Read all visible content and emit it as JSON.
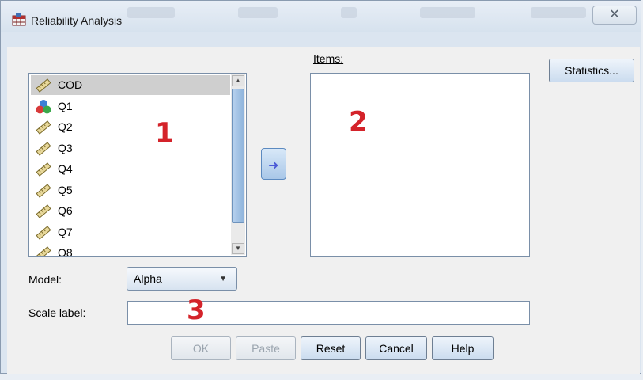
{
  "window": {
    "title": "Reliability Analysis",
    "close_glyph": "✕"
  },
  "variables": {
    "items": [
      {
        "label": "COD",
        "icon": "ruler-icon",
        "selected": true
      },
      {
        "label": "Q1",
        "icon": "nominal-balls-icon",
        "selected": false
      },
      {
        "label": "Q2",
        "icon": "ruler-icon",
        "selected": false
      },
      {
        "label": "Q3",
        "icon": "ruler-icon",
        "selected": false
      },
      {
        "label": "Q4",
        "icon": "ruler-icon",
        "selected": false
      },
      {
        "label": "Q5",
        "icon": "ruler-icon",
        "selected": false
      },
      {
        "label": "Q6",
        "icon": "ruler-icon",
        "selected": false
      },
      {
        "label": "Q7",
        "icon": "ruler-icon",
        "selected": false
      },
      {
        "label": "Q8",
        "icon": "ruler-icon",
        "selected": false
      }
    ]
  },
  "annotations": {
    "n1": "1",
    "n2": "2",
    "n3": "3"
  },
  "items": {
    "label": "Items:",
    "values": []
  },
  "buttons": {
    "statistics": "Statistics...",
    "ok": "OK",
    "paste": "Paste",
    "reset": "Reset",
    "cancel": "Cancel",
    "help": "Help",
    "move_glyph": "➜"
  },
  "model": {
    "label": "Model:",
    "value": "Alpha"
  },
  "scale": {
    "label": "Scale label:",
    "value": ""
  },
  "colors": {
    "annotation_red": "#d4232a",
    "selection_gray": "#cfcfcf"
  }
}
